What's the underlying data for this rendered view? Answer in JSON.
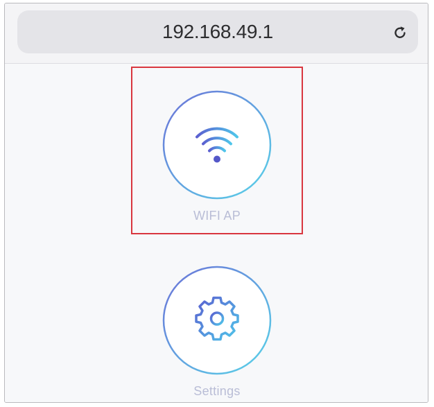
{
  "address_bar": {
    "url": "192.168.49.1",
    "reload_icon": "reload-icon"
  },
  "menu": {
    "items": [
      {
        "label": "WIFI AP",
        "icon": "wifi-icon",
        "highlighted": true
      },
      {
        "label": "Settings",
        "icon": "gear-icon",
        "highlighted": false
      }
    ]
  },
  "colors": {
    "ring_start": "#6c72d8",
    "ring_end": "#58d3e8",
    "icon_start": "#5b5fd0",
    "icon_end": "#4fc6ea",
    "label": "#b9bdd6",
    "highlight_border": "#d9363e"
  }
}
